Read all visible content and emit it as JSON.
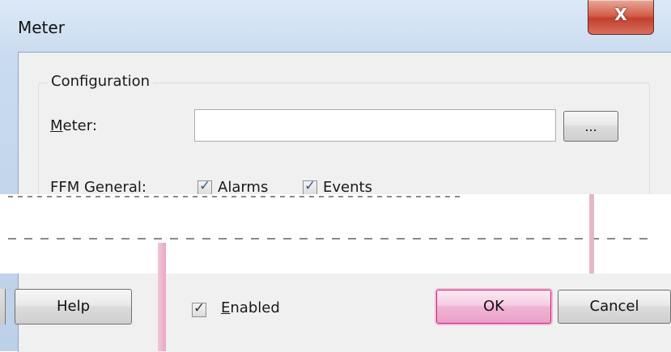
{
  "window": {
    "title": "Meter",
    "close_glyph": "X"
  },
  "configuration": {
    "group_title": "Configuration",
    "meter_label_access": "M",
    "meter_label_rest": "eter:",
    "meter_value": "",
    "browse_label": "...",
    "ffm_label": "FFM General:",
    "alarms_label": "Alarms",
    "alarms_checked": true,
    "events_label": "Events",
    "events_checked": true
  },
  "footer": {
    "help_label": "Help",
    "enabled_access": "E",
    "enabled_rest": "nabled",
    "enabled_checked": true,
    "ok_label": "OK",
    "cancel_label": "Cancel"
  },
  "colors": {
    "default_button_border": "#c02c7c",
    "titlebar_gradient_top": "#dce9f7",
    "close_button": "#c24030"
  }
}
